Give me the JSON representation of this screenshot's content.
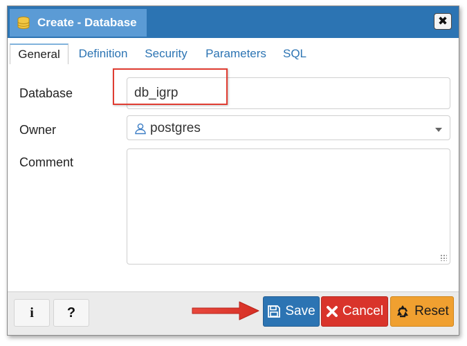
{
  "dialog": {
    "title": "Create - Database",
    "close_label": "✖",
    "icon": "database-icon"
  },
  "tabs": [
    {
      "label": "General",
      "active": true
    },
    {
      "label": "Definition",
      "active": false
    },
    {
      "label": "Security",
      "active": false
    },
    {
      "label": "Parameters",
      "active": false
    },
    {
      "label": "SQL",
      "active": false
    }
  ],
  "form": {
    "database_label": "Database",
    "database_value": "db_igrp",
    "owner_label": "Owner",
    "owner_value": "postgres",
    "owner_icon": "user-icon",
    "comment_label": "Comment",
    "comment_value": ""
  },
  "footer": {
    "info_label": "i",
    "help_label": "?",
    "save_label": "Save",
    "cancel_label": "Cancel",
    "reset_label": "Reset"
  },
  "colors": {
    "titlebar": "#2c74b3",
    "title_tab": "#5b9bd5",
    "save": "#2c74b3",
    "cancel": "#d9342b",
    "reset": "#f0a030",
    "annotation": "#e03c31"
  }
}
